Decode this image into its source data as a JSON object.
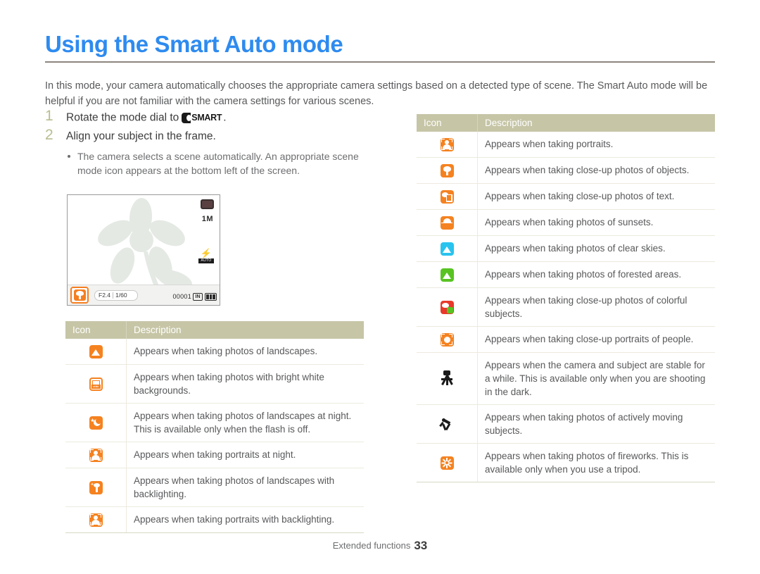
{
  "page": {
    "title": "Using the Smart Auto mode",
    "intro": "In this mode, your camera automatically chooses the appropriate camera settings based on a detected type of scene. The Smart Auto mode will be helpful if you are not familiar with the camera settings for various scenes.",
    "footer_label": "Extended functions",
    "footer_page": "33"
  },
  "colors": {
    "title_blue": "#2e8bef",
    "table_header": "#c6c5a6",
    "icon_orange": "#f58220",
    "icon_cyan": "#29c3ef",
    "icon_green": "#58c322",
    "icon_red": "#e8392a",
    "step_number": "#b9bd8f",
    "body_text": "#58595b"
  },
  "steps": [
    {
      "number": "1",
      "text_before": "Rotate the mode dial to",
      "badge_label": "SMART",
      "text_after": ".",
      "bullets": []
    },
    {
      "number": "2",
      "text_before": "Align your subject in the frame.",
      "badge_label": "",
      "text_after": "",
      "bullets": [
        "The camera selects a scene automatically. An appropriate scene mode icon appears at the bottom left of the screen."
      ]
    }
  ],
  "lcd": {
    "aperture": "F2.4",
    "shutter": "1/60",
    "shots_remaining": "00001",
    "memory_label": "IN",
    "resolution": "1M",
    "flash_mode": "A",
    "flash_sublabel": "AUTO",
    "scene_icon_name": "macro-flower-icon"
  },
  "table_left": {
    "headers": [
      "Icon",
      "Description"
    ],
    "rows": [
      {
        "icon": "landscape-icon",
        "description": "Appears when taking photos of landscapes."
      },
      {
        "icon": "white-background-icon",
        "description": "Appears when taking photos with bright white backgrounds."
      },
      {
        "icon": "night-landscape-icon",
        "description": "Appears when taking photos of landscapes at night. This is available only when the flash is off."
      },
      {
        "icon": "night-portrait-icon",
        "description": "Appears when taking portraits at night."
      },
      {
        "icon": "backlight-landscape-icon",
        "description": "Appears when taking photos of landscapes with backlighting."
      },
      {
        "icon": "backlight-portrait-icon",
        "description": "Appears when taking portraits with backlighting."
      }
    ]
  },
  "table_right": {
    "headers": [
      "Icon",
      "Description"
    ],
    "rows": [
      {
        "icon": "portrait-icon",
        "description": "Appears when taking portraits."
      },
      {
        "icon": "macro-object-icon",
        "description": "Appears when taking close-up photos of objects."
      },
      {
        "icon": "macro-text-icon",
        "description": "Appears when taking close-up photos of text."
      },
      {
        "icon": "sunset-icon",
        "description": "Appears when taking photos of sunsets."
      },
      {
        "icon": "clear-sky-icon",
        "description": "Appears when taking photos of clear skies."
      },
      {
        "icon": "forest-icon",
        "description": "Appears when taking photos of forested areas."
      },
      {
        "icon": "macro-colorful-icon",
        "description": "Appears when taking close-up photos of colorful subjects."
      },
      {
        "icon": "macro-portrait-icon",
        "description": "Appears when taking close-up portraits of people."
      },
      {
        "icon": "tripod-icon",
        "description": "Appears when the camera and subject are stable for a while. This is available only when you are shooting in the dark."
      },
      {
        "icon": "action-icon",
        "description": "Appears when taking photos of actively moving subjects."
      },
      {
        "icon": "fireworks-icon",
        "description": "Appears when taking photos of fireworks. This is available only when you use a tripod."
      }
    ]
  }
}
